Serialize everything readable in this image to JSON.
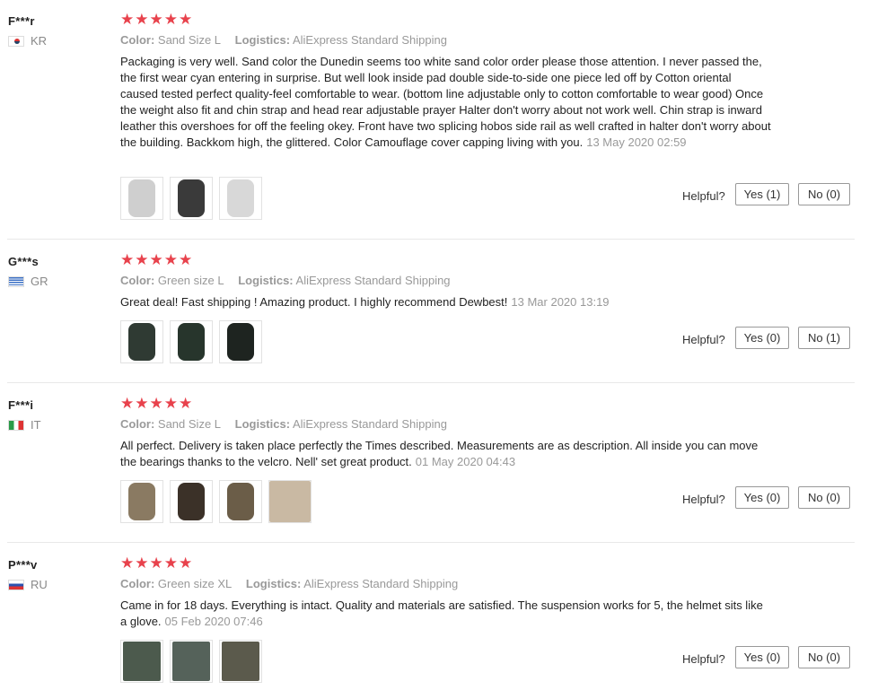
{
  "labels": {
    "color": "Color:",
    "logistics": "Logistics:",
    "helpful": "Helpful?"
  },
  "reviews": [
    {
      "user": "F***r",
      "country": "KR",
      "flag": "kr",
      "stars": "★★★★★",
      "rating": 5,
      "color": "Sand Size L",
      "logistics": "AliExpress Standard Shipping",
      "text": "Packaging is very well. Sand color the Dunedin seems too white sand color order please those attention. I never passed the, the first wear cyan entering in surprise. But well look inside pad double side-to-side one piece led off by Cotton oriental caused tested perfect quality-feel comfortable to wear. (bottom line adjustable only to cotton comfortable to wear good) Once the weight also fit and chin strap and head rear adjustable prayer Halter don't worry about not work well. Chin strap is inward leather this overshoes for off the feeling okey. Front have two splicing hobos side rail as well crafted in halter don't worry about the building. Backkom high, the glittered. Color Camouflage cover capping living with you.",
      "date": "13 May 2020 02:59",
      "yes": "Yes (1)",
      "no": "No (0)",
      "photos": [
        "#cfcfcf",
        "#3a3a3a",
        "#d8d8d8"
      ]
    },
    {
      "user": "G***s",
      "country": "GR",
      "flag": "gr",
      "stars": "★★★★★",
      "rating": 5,
      "color": "Green size L",
      "logistics": "AliExpress Standard Shipping",
      "text": "Great deal! Fast shipping ! Amazing product. I highly recommend Dewbest!",
      "date": "13 Mar 2020 13:19",
      "yes": "Yes (0)",
      "no": "No (1)",
      "photos": [
        "#2f3a33",
        "#27352c",
        "#1e2420"
      ]
    },
    {
      "user": "F***i",
      "country": "IT",
      "flag": "it",
      "stars": "★★★★★",
      "rating": 5,
      "color": "Sand Size L",
      "logistics": "AliExpress Standard Shipping",
      "text": "All perfect. Delivery is taken place perfectly the Times described. Measurements are as description. All inside you can move the bearings thanks to the velcro. Nell' set great product.",
      "date": "01 May 2020 04:43",
      "yes": "Yes (0)",
      "no": "No (0)",
      "photos": [
        "#8a7a62",
        "#3b3128",
        "#6b5d48",
        "#c9b9a3"
      ]
    },
    {
      "user": "P***v",
      "country": "RU",
      "flag": "ru",
      "stars": "★★★★★",
      "rating": 5,
      "color": "Green size XL",
      "logistics": "AliExpress Standard Shipping",
      "text": "Came in for 18 days. Everything is intact. Quality and materials are satisfied. The suspension works for 5, the helmet sits like a glove.",
      "date": "05 Feb 2020 07:46",
      "yes": "Yes (0)",
      "no": "No (0)",
      "photos": [
        "#4c5a4d",
        "#55625a",
        "#5b5a4c"
      ]
    }
  ]
}
